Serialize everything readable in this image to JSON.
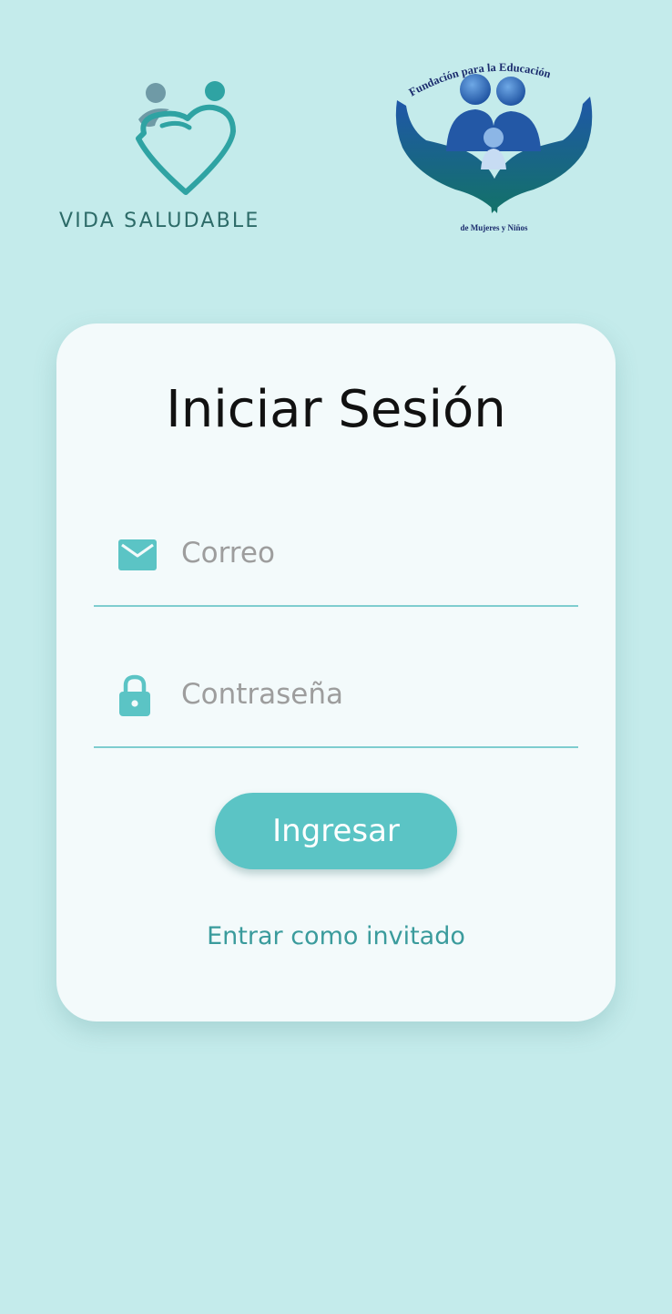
{
  "header": {
    "logo_left": {
      "text": "VIDA SALUDABLE",
      "icon": "people-heart-logo-icon",
      "colors": {
        "primary": "#2fa3a3",
        "secondary": "#6f9aa6"
      }
    },
    "logo_right": {
      "arc_text": "Fundación para la Educación",
      "bottom_text": "de Mujeres y Niños",
      "icon": "hands-family-logo-icon",
      "colors": {
        "blue": "#1f57a8",
        "teal": "#1b7d78"
      }
    }
  },
  "login": {
    "title": "Iniciar Sesión",
    "email": {
      "placeholder": "Correo",
      "value": "",
      "icon": "envelope-icon"
    },
    "password": {
      "placeholder": "Contraseña",
      "value": "",
      "icon": "lock-icon"
    },
    "submit_label": "Ingresar",
    "guest_label": "Entrar como invitado"
  },
  "theme": {
    "background": "#c4ebeb",
    "card": "#f3fafb",
    "accent": "#5bc4c5",
    "link": "#3a9b9c",
    "placeholder": "#9d9d9d"
  }
}
